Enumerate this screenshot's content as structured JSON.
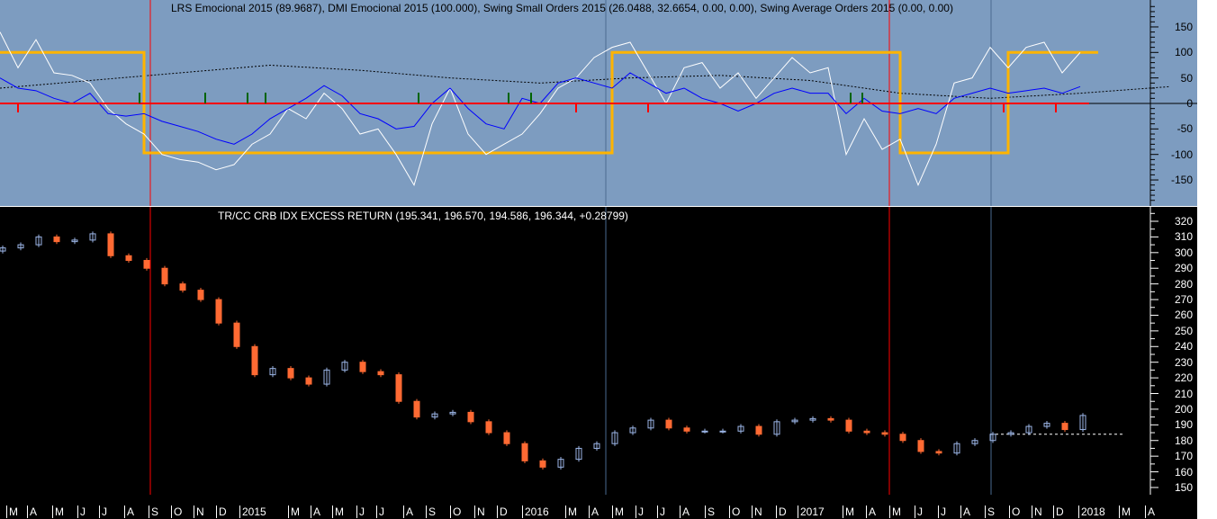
{
  "upper_panel": {
    "title": "LRS Emocional 2015 (89.9687), DMI Emocional 2015 (100.000), Swing Small Orders 2015 (26.0488, 32.6654, 0.00, 0.00), Swing Average Orders 2015 (0.00, 0.00)",
    "y_ticks": [
      "150",
      "100",
      "50",
      "0",
      "-50",
      "-100",
      "-150"
    ],
    "y_values": [
      150,
      100,
      50,
      0,
      -50,
      -100,
      -150
    ],
    "colors": {
      "lrs": "#ffffff",
      "dmi": "#0000ff",
      "swing": "#ffb400",
      "avg": "#000000",
      "zero": "#ff0000",
      "bg": "#7d9cc0"
    },
    "lrs": [
      140,
      70,
      125,
      60,
      55,
      40,
      -10,
      -40,
      -60,
      -100,
      -110,
      -115,
      -130,
      -120,
      -80,
      -60,
      -10,
      -30,
      20,
      -10,
      -60,
      -50,
      -100,
      -160,
      -40,
      30,
      -60,
      -100,
      -80,
      -60,
      -20,
      30,
      50,
      90,
      110,
      120,
      60,
      0,
      70,
      80,
      30,
      60,
      10,
      50,
      90,
      60,
      70,
      -100,
      -30,
      -90,
      -70,
      -160,
      -80,
      40,
      50,
      110,
      70,
      110,
      120,
      60,
      100
    ],
    "dmi": [
      50,
      30,
      25,
      10,
      0,
      20,
      -20,
      -25,
      -20,
      -35,
      -45,
      -55,
      -70,
      -80,
      -60,
      -30,
      -10,
      10,
      35,
      15,
      -20,
      -30,
      -50,
      -45,
      0,
      30,
      -10,
      -40,
      -50,
      10,
      0,
      40,
      50,
      40,
      30,
      60,
      40,
      20,
      30,
      10,
      0,
      -15,
      0,
      20,
      30,
      20,
      20,
      -20,
      10,
      -15,
      -20,
      -10,
      -20,
      10,
      20,
      30,
      20,
      25,
      30,
      20,
      33
    ],
    "avg": [
      30,
      45,
      60,
      75,
      65,
      50,
      40,
      50,
      55,
      45,
      20,
      10,
      20,
      33
    ],
    "swing": [
      100,
      100,
      100,
      100,
      100,
      100,
      100,
      100,
      -97,
      -97,
      -97,
      -97,
      -97,
      -97,
      -97,
      -97,
      -97,
      -97,
      -97,
      -97,
      -97,
      -97,
      -97,
      -97,
      -97,
      -97,
      -97,
      -97,
      -97,
      -97,
      -97,
      -97,
      -97,
      -97,
      100,
      100,
      100,
      100,
      100,
      100,
      100,
      100,
      100,
      100,
      100,
      100,
      100,
      100,
      100,
      100,
      -97,
      -97,
      -97,
      -97,
      -97,
      -97,
      100,
      100,
      100,
      100,
      100,
      100
    ]
  },
  "lower_panel": {
    "title": "TR/CC CRB IDX EXCESS RETURN (195.341, 196.570, 194.586, 196.344, +0.28799)",
    "y_ticks": [
      "320",
      "310",
      "300",
      "290",
      "280",
      "270",
      "260",
      "250",
      "240",
      "230",
      "220",
      "210",
      "200",
      "190",
      "180",
      "170",
      "160",
      "150"
    ],
    "y_values": [
      320,
      310,
      300,
      290,
      280,
      270,
      260,
      250,
      240,
      230,
      220,
      210,
      200,
      190,
      180,
      170,
      160,
      150
    ],
    "colors": {
      "up": "#9bb5e6",
      "down": "#ff6a33",
      "bg": "#000000",
      "ref_line": "#ffffff"
    },
    "closes": [
      303,
      305,
      310,
      307,
      308,
      312,
      298,
      295,
      290,
      280,
      276,
      270,
      255,
      240,
      222,
      226,
      220,
      216,
      225,
      230,
      224,
      222,
      205,
      195,
      197,
      198,
      192,
      185,
      178,
      167,
      163,
      168,
      175,
      178,
      185,
      188,
      193,
      188,
      186,
      186,
      186,
      189,
      184,
      192,
      193,
      194,
      193,
      186,
      185,
      184,
      180,
      173,
      172,
      178,
      180,
      184,
      185,
      189,
      191,
      187,
      196
    ],
    "ref_level": 184
  },
  "time_axis": {
    "labels": [
      "M",
      "A",
      "M",
      "J",
      "J",
      "A",
      "S",
      "O",
      "N",
      "D",
      "2015",
      "M",
      "A",
      "M",
      "J",
      "J",
      "A",
      "S",
      "O",
      "N",
      "D",
      "2016",
      "M",
      "A",
      "M",
      "J",
      "J",
      "A",
      "S",
      "O",
      "N",
      "D",
      "2017",
      "M",
      "A",
      "M",
      "J",
      "J",
      "A",
      "S",
      "O",
      "N",
      "D",
      "2018",
      "M",
      "A"
    ]
  }
}
